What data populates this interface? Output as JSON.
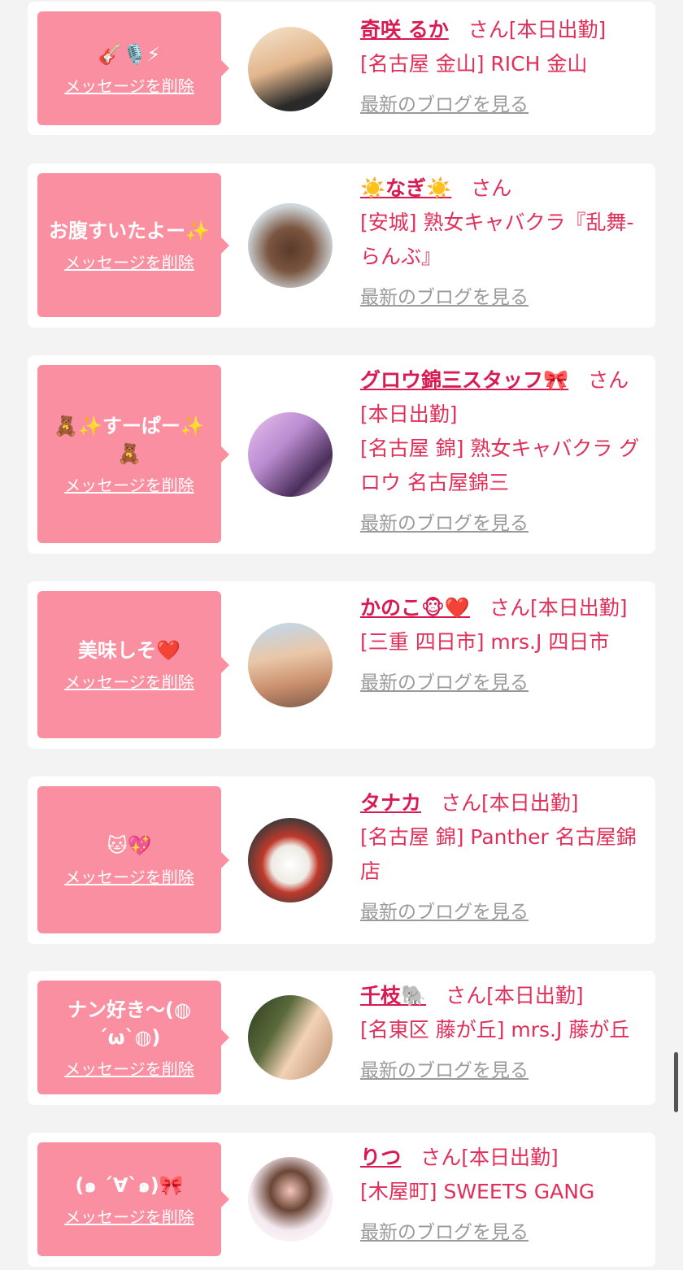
{
  "cards": [
    {
      "message": "🎸🎙️⚡",
      "delete_label": "メッセージを削除",
      "name": "奇咲 るか",
      "suffix": "さん[本日出勤]",
      "shop": "[名古屋 金山] RICH 金山",
      "blog_label": "最新のブログを見る"
    },
    {
      "message": "お腹すいたよー✨",
      "delete_label": "メッセージを削除",
      "name": "☀️なぎ☀️",
      "suffix": "さん",
      "shop": "[安城] 熟女キャバクラ『乱舞-らんぶ』",
      "blog_label": "最新のブログを見る"
    },
    {
      "message": "🧸✨すーぱー✨🧸",
      "delete_label": "メッセージを削除",
      "name": "グロウ錦三スタッフ🎀",
      "suffix": "さん[本日出勤]",
      "shop": "[名古屋 錦] 熟女キャバクラ グロウ 名古屋錦三",
      "blog_label": "最新のブログを見る"
    },
    {
      "message": "美味しそ❤️",
      "delete_label": "メッセージを削除",
      "name": "かのこ🐵❤️",
      "suffix": "さん[本日出勤]",
      "shop": "[三重 四日市] mrs.J 四日市",
      "blog_label": "最新のブログを見る"
    },
    {
      "message": "🐱💖",
      "delete_label": "メッセージを削除",
      "name": "タナカ",
      "suffix": "さん[本日出勤]",
      "shop": "[名古屋 錦] Panther 名古屋錦店",
      "blog_label": "最新のブログを見る"
    },
    {
      "message": "ナン好き〜(◍´ω`◍)",
      "delete_label": "メッセージを削除",
      "name": "千枝🐘",
      "suffix": "さん[本日出勤]",
      "shop": "[名東区 藤が丘] mrs.J 藤が丘",
      "blog_label": "最新のブログを見る"
    },
    {
      "message": "(๑ ´∀`๑)🎀",
      "delete_label": "メッセージを削除",
      "name": "りつ",
      "suffix": "さん[本日出勤]",
      "shop": "[木屋町] SWEETS GANG",
      "blog_label": "最新のブログを見る"
    }
  ],
  "colors": {
    "bubble": "#f98fa0",
    "name": "#d81b52",
    "text": "#e0305a",
    "link_gray": "#9a9a9a",
    "page_bg": "#f3f3f3"
  }
}
